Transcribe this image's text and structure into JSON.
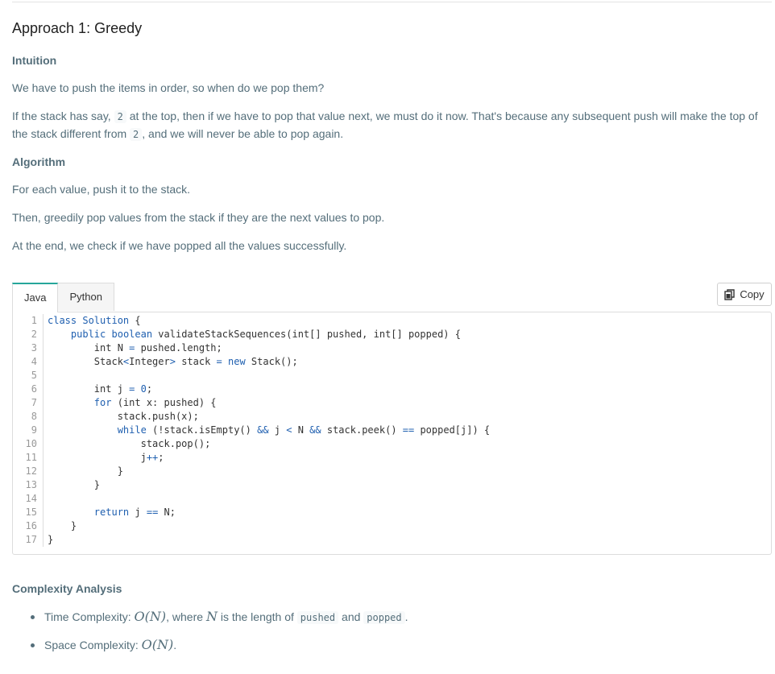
{
  "article": {
    "heading": "Approach 1: Greedy",
    "intuition_label": "Intuition",
    "intuition_p1": "We have to push the items in order, so when do we pop them?",
    "intuition_p2_a": "If the stack has say, ",
    "intuition_p2_code1": "2",
    "intuition_p2_b": " at the top, then if we have to pop that value next, we must do it now. That's because any subsequent push will make the top of the stack different from ",
    "intuition_p2_code2": "2",
    "intuition_p2_c": ", and we will never be able to pop again.",
    "algorithm_label": "Algorithm",
    "algorithm_p1": "For each value, push it to the stack.",
    "algorithm_p2": "Then, greedily pop values from the stack if they are the next values to pop.",
    "algorithm_p3": "At the end, we check if we have popped all the values successfully."
  },
  "code_panel": {
    "tabs": [
      {
        "label": "Java",
        "active": true
      },
      {
        "label": "Python",
        "active": false
      }
    ],
    "copy_label": "Copy",
    "copy_icon": "copy-icon",
    "lines": [
      "class Solution {",
      "    public boolean validateStackSequences(int[] pushed, int[] popped) {",
      "        int N = pushed.length;",
      "        Stack<Integer> stack = new Stack();",
      "",
      "        int j = 0;",
      "        for (int x: pushed) {",
      "            stack.push(x);",
      "            while (!stack.isEmpty() && j < N && stack.peek() == popped[j]) {",
      "                stack.pop();",
      "                j++;",
      "            }",
      "        }",
      "",
      "        return j == N;",
      "    }",
      "}"
    ],
    "line_numbers": [
      "1",
      "2",
      "3",
      "4",
      "5",
      "6",
      "7",
      "8",
      "9",
      "10",
      "11",
      "12",
      "13",
      "14",
      "15",
      "16",
      "17"
    ]
  },
  "complexity": {
    "label": "Complexity Analysis",
    "time_prefix": "Time Complexity: ",
    "time_math": "O(N)",
    "time_mid": ", where ",
    "time_var": "N",
    "time_mid2": " is the length of ",
    "time_code1": "pushed",
    "time_and": " and ",
    "time_code2": "popped",
    "time_end": ".",
    "space_prefix": "Space Complexity: ",
    "space_math": "O(N)",
    "space_end": "."
  },
  "colors": {
    "accent": "#26a69a",
    "text": "#546e7a",
    "keyword": "#2060b0"
  }
}
